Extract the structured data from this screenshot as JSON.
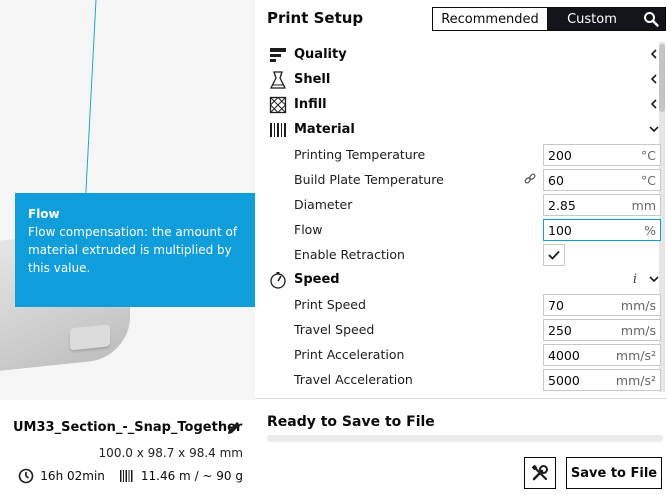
{
  "tooltip": {
    "title": "Flow",
    "body": "Flow compensation: the amount of material extruded is multiplied by this value."
  },
  "job": {
    "name": "UM33_Section_-_Snap_Together",
    "dimensions": "100.0 x 98.7 x 98.4 mm",
    "print_time": "16h 02min",
    "material_usage": "11.46 m / ~ 90 g",
    "icons": {
      "edit": "pencil-icon",
      "time": "clock-icon",
      "material": "spool-icon"
    }
  },
  "panel": {
    "title": "Print Setup",
    "mode_recommended": "Recommended",
    "mode_custom": "Custom",
    "search_icon": "search-icon"
  },
  "categories": {
    "quality": {
      "label": "Quality",
      "icon": "quality-icon",
      "expanded": false
    },
    "shell": {
      "label": "Shell",
      "icon": "shell-icon",
      "expanded": false
    },
    "infill": {
      "label": "Infill",
      "icon": "infill-icon",
      "expanded": false
    },
    "material": {
      "label": "Material",
      "icon": "material-icon",
      "expanded": true
    },
    "speed": {
      "label": "Speed",
      "icon": "speed-icon",
      "expanded": true,
      "info": "i"
    }
  },
  "material_settings": {
    "printing_temperature": {
      "label": "Printing Temperature",
      "value": "200",
      "unit": "°C"
    },
    "build_plate_temperature": {
      "label": "Build Plate Temperature",
      "value": "60",
      "unit": "°C"
    },
    "diameter": {
      "label": "Diameter",
      "value": "2.85",
      "unit": "mm"
    },
    "flow": {
      "label": "Flow",
      "value": "100",
      "unit": "%"
    },
    "enable_retraction": {
      "label": "Enable Retraction",
      "checked": true
    }
  },
  "speed_settings": {
    "print_speed": {
      "label": "Print Speed",
      "value": "70",
      "unit": "mm/s"
    },
    "travel_speed": {
      "label": "Travel Speed",
      "value": "250",
      "unit": "mm/s"
    },
    "print_acceleration": {
      "label": "Print Acceleration",
      "value": "4000",
      "unit": "mm/s²"
    },
    "travel_acceleration": {
      "label": "Travel Acceleration",
      "value": "5000",
      "unit": "mm/s²"
    }
  },
  "save": {
    "status": "Ready to Save to File",
    "button": "Save to File",
    "progress": 0
  },
  "colors": {
    "accent": "#0f9ddb",
    "dark": "#12141a",
    "border": "#c8c8c8"
  }
}
